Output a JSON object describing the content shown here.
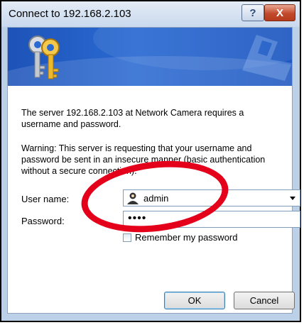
{
  "window": {
    "title": "Connect to 192.168.2.103"
  },
  "titlebar": {
    "help_label": "?",
    "close_label": "X"
  },
  "message": {
    "server": "The server 192.168.2.103 at Network Camera requires a username and password.",
    "warning": "Warning: This server is requesting that your username and password be sent in an insecure manner (basic authentication without a secure connection)."
  },
  "form": {
    "user_label": "User name:",
    "user_value": "admin",
    "password_label": "Password:",
    "password_value": "••••",
    "remember_label": "Remember my password",
    "remember_checked": false
  },
  "buttons": {
    "ok": "OK",
    "cancel": "Cancel"
  },
  "icons": {
    "keys": "keys-icon",
    "user": "user-icon",
    "dropdown": "chevron-down-icon",
    "close": "close-icon",
    "help": "help-icon"
  },
  "colors": {
    "banner": "#1d53b8",
    "annotation_ring": "#e4001b"
  }
}
